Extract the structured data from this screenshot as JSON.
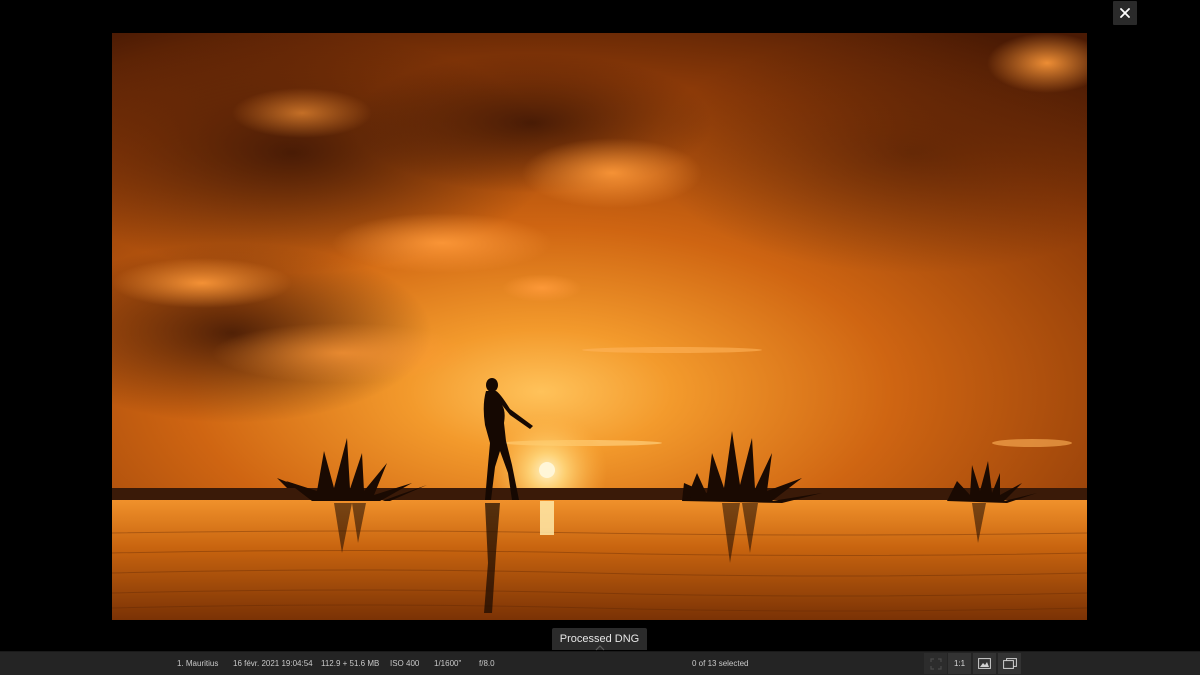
{
  "viewer": {
    "close_icon": "close-icon",
    "photo_description_icon": "photo-preview",
    "version_tab_label": "Processed DNG",
    "version_caret_icon": "chevron-up-icon"
  },
  "status_bar": {
    "collection": "1. Mauritius",
    "date": "16 févr. 2021 19:04:54",
    "file_size": "112.9 + 51.6 MB",
    "iso": "ISO 400",
    "shutter": "1/1600\"",
    "aperture": "f/8.0",
    "selection": "0 of 13 selected",
    "zoom_label": "1:1",
    "tools": [
      "fit-screen-icon",
      "one-to-one",
      "single-image-icon",
      "compare-icon"
    ]
  },
  "colors": {
    "background": "#000000",
    "status_bar": "#242424",
    "tab": "#2b2b2b",
    "sky_top": "#5a2206",
    "sky_mid": "#c2540e",
    "horizon": "#f7a236"
  }
}
